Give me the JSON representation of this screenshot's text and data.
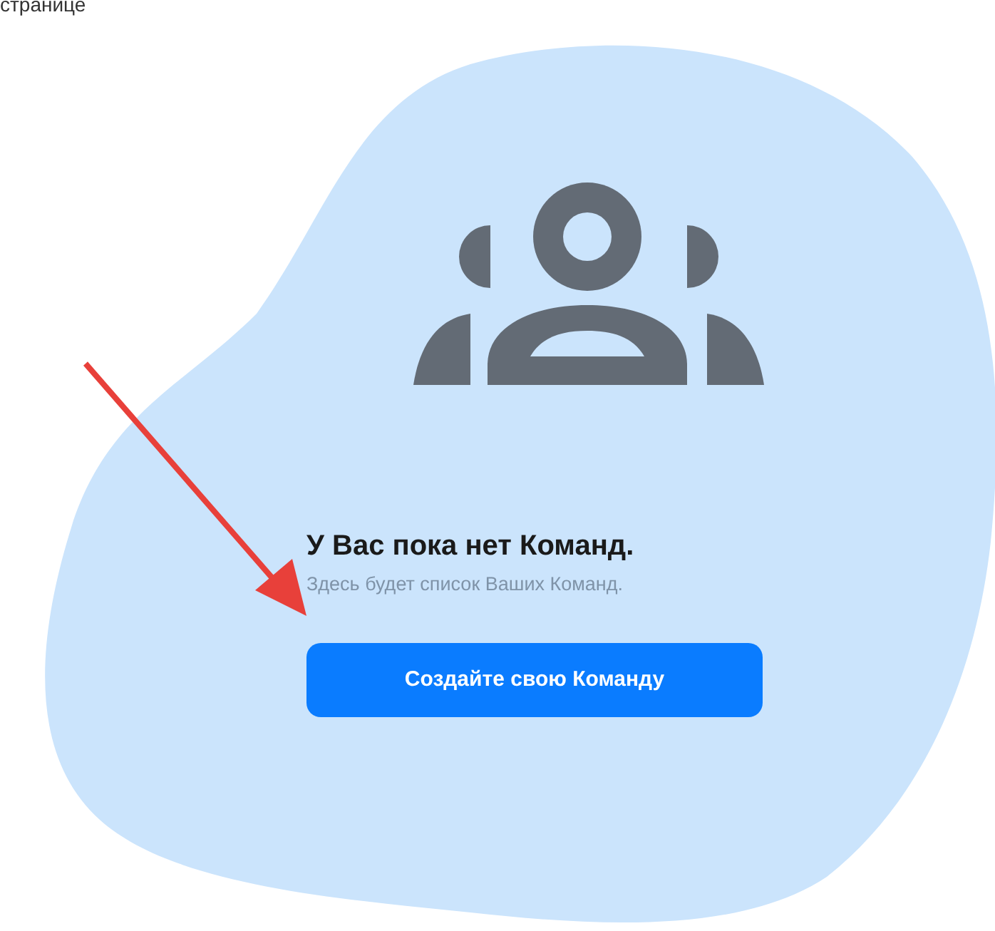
{
  "top_text": "странице",
  "empty_state": {
    "title": "У Вас пока нет Команд.",
    "subtitle": "Здесь будет список Ваших Команд.",
    "button": "Создайте свою Команду"
  }
}
